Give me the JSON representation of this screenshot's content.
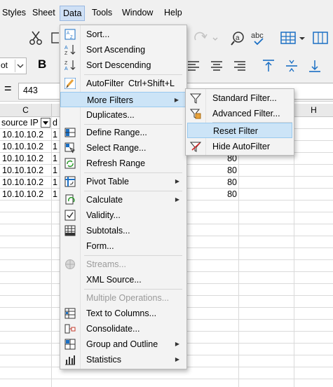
{
  "menubar": {
    "items": [
      "Styles",
      "Sheet",
      "Data",
      "Tools",
      "Window",
      "Help"
    ],
    "active": "Data"
  },
  "toolbar": {
    "font_size_partial": "ot"
  },
  "formula": {
    "equals": "=",
    "value": "443"
  },
  "grid": {
    "col_c": "C",
    "col_h": "H",
    "header_c": "source IP",
    "header_d_partial": "d",
    "rows": [
      {
        "c": "10.10.10.2",
        "d": "1",
        "g": ""
      },
      {
        "c": "10.10.10.2",
        "d": "1",
        "g": ""
      },
      {
        "c": "10.10.10.2",
        "d": "1",
        "g": "80"
      },
      {
        "c": "10.10.10.2",
        "d": "1",
        "g": "80"
      },
      {
        "c": "10.10.10.2",
        "d": "1",
        "g": "80"
      },
      {
        "c": "10.10.10.2",
        "d": "1",
        "g": "80"
      }
    ]
  },
  "data_menu": {
    "sort": "Sort...",
    "sort_asc": "Sort Ascending",
    "sort_desc": "Sort Descending",
    "autofilter": "AutoFilter",
    "autofilter_shortcut": "Ctrl+Shift+L",
    "more_filters": "More Filters",
    "duplicates": "Duplicates...",
    "define_range": "Define Range...",
    "select_range": "Select Range...",
    "refresh_range": "Refresh Range",
    "pivot_table": "Pivot Table",
    "calculate": "Calculate",
    "validity": "Validity...",
    "subtotals": "Subtotals...",
    "form": "Form...",
    "streams": "Streams...",
    "xml_source": "XML Source...",
    "multiple_operations": "Multiple Operations...",
    "text_to_columns": "Text to Columns...",
    "consolidate": "Consolidate...",
    "group_outline": "Group and Outline",
    "statistics": "Statistics"
  },
  "filters_submenu": {
    "standard": "Standard Filter...",
    "advanced": "Advanced Filter...",
    "reset": "Reset Filter",
    "hide_autofilter": "Hide AutoFilter"
  },
  "colors": {
    "highlight": "#cce4f7",
    "menu_bg": "#f3f3f3",
    "accent": "#1a6fc4"
  }
}
